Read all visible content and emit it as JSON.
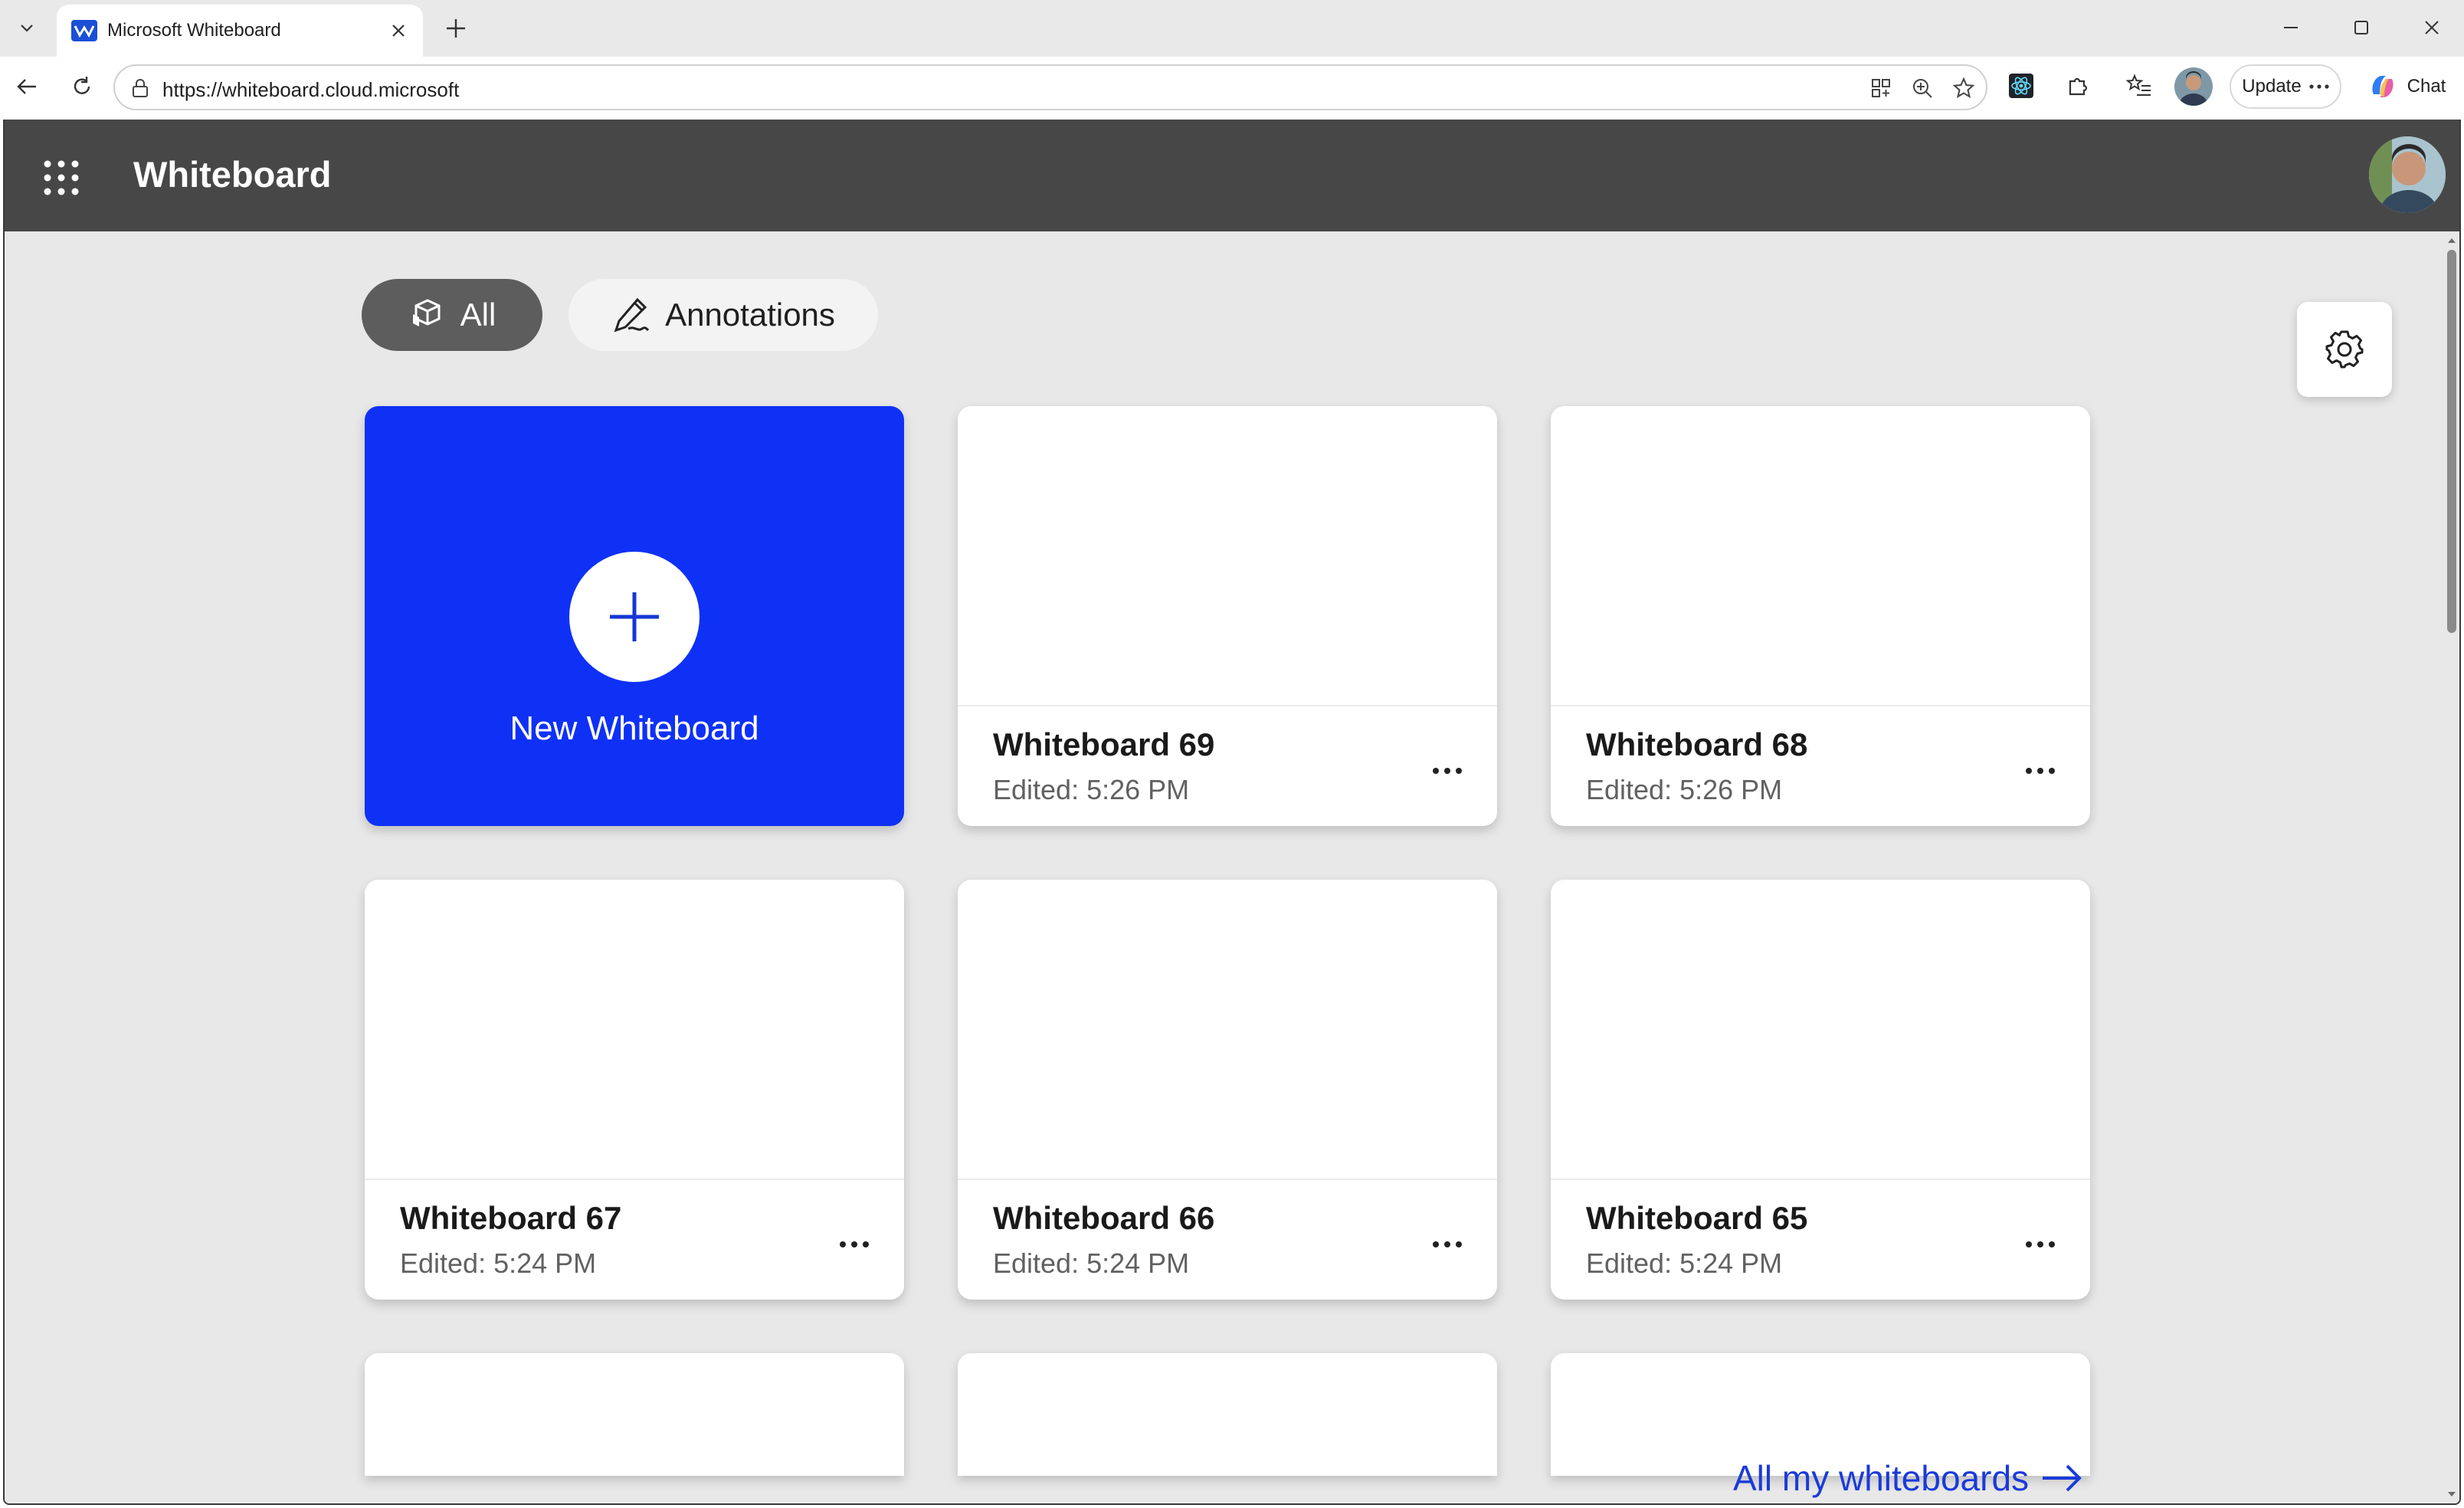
{
  "browser": {
    "tab_title": "Microsoft Whiteboard",
    "url": "https://whiteboard.cloud.microsoft",
    "update_label": "Update",
    "chat_label": "Chat"
  },
  "app": {
    "title": "Whiteboard",
    "filters": [
      {
        "label": "All",
        "icon": "cubes-icon",
        "selected": true
      },
      {
        "label": "Annotations",
        "icon": "pen-annotate-icon",
        "selected": false
      }
    ],
    "new_whiteboard_label": "New Whiteboard",
    "boards": [
      {
        "name": "Whiteboard 69",
        "edited": "Edited: 5:26 PM"
      },
      {
        "name": "Whiteboard 68",
        "edited": "Edited: 5:26 PM"
      },
      {
        "name": "Whiteboard 67",
        "edited": "Edited: 5:24 PM"
      },
      {
        "name": "Whiteboard 66",
        "edited": "Edited: 5:24 PM"
      },
      {
        "name": "Whiteboard 65",
        "edited": "Edited: 5:24 PM"
      }
    ],
    "all_link_label": "All my whiteboards"
  },
  "colors": {
    "accent_blue": "#0f31f5",
    "appbar": "#474747",
    "background": "#e8e8e8",
    "link": "#1a3bd9"
  }
}
